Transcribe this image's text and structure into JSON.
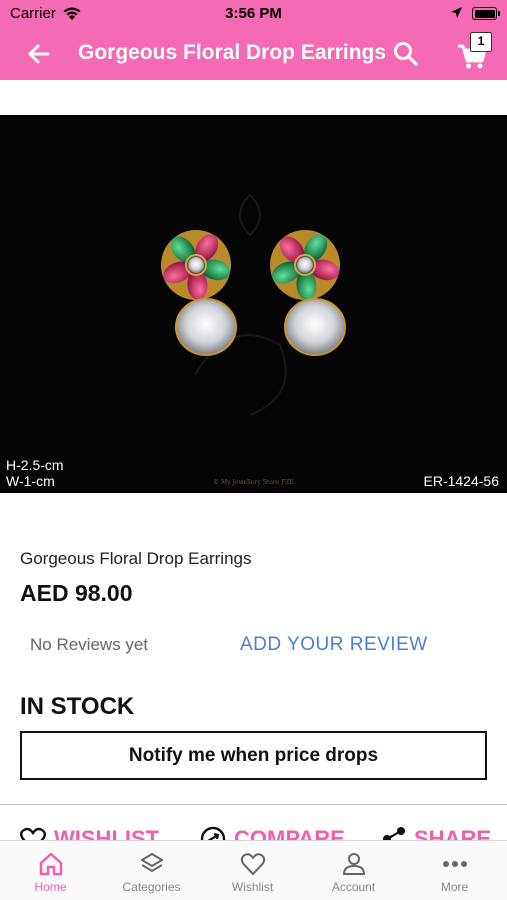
{
  "status_bar": {
    "carrier": "Carrier",
    "time": "3:56 PM"
  },
  "header": {
    "title": "Gorgeous Floral Drop Earrings",
    "cart_count": "1"
  },
  "image": {
    "dimensions_height": "H-2.5-cm",
    "dimensions_width": "W-1-cm",
    "product_code": "ER-1424-56",
    "copyright": "© My Jewellery Store FZE"
  },
  "product": {
    "name": "Gorgeous Floral Drop Earrings",
    "price": "AED 98.00",
    "reviews_text": "No Reviews yet",
    "add_review_label": "ADD YOUR REVIEW",
    "stock_status": "IN STOCK",
    "notify_label": "Notify me when price drops"
  },
  "actions": {
    "wishlist": "WISHLIST",
    "compare": "COMPARE",
    "share": "SHARE"
  },
  "tabs": [
    {
      "label": "Home",
      "icon": "home-icon",
      "active": true
    },
    {
      "label": "Categories",
      "icon": "layers-icon",
      "active": false
    },
    {
      "label": "Wishlist",
      "icon": "heart-icon",
      "active": false
    },
    {
      "label": "Account",
      "icon": "person-icon",
      "active": false
    },
    {
      "label": "More",
      "icon": "more-dots-icon",
      "active": false
    }
  ],
  "colors": {
    "brand_pink": "#f46ab3",
    "accent_pink": "#f45dad",
    "link_blue": "#4a7fd4"
  }
}
